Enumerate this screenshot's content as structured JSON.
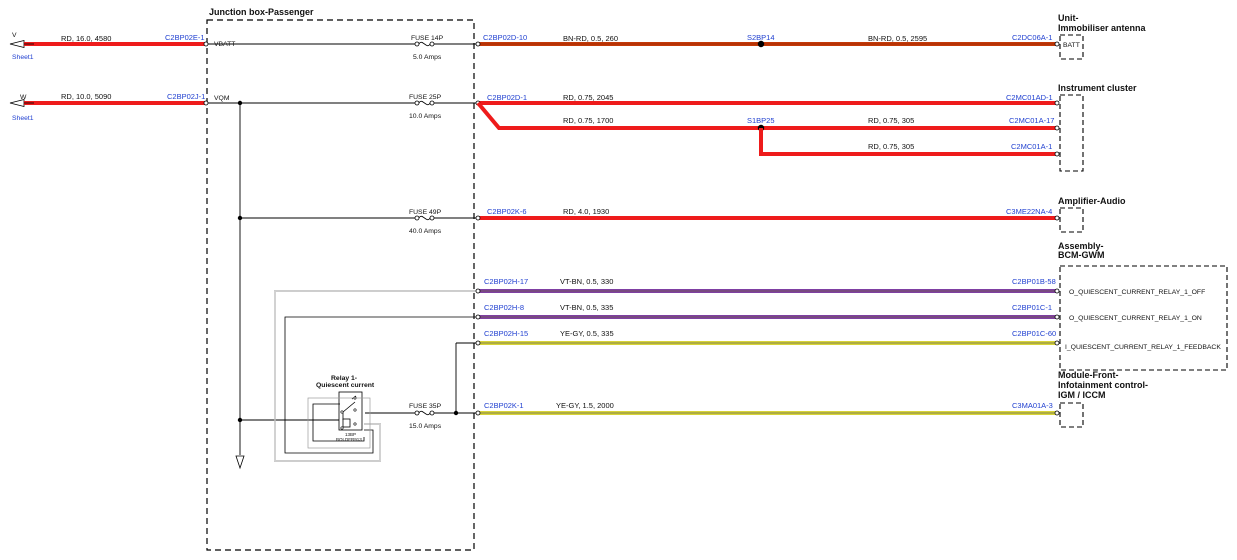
{
  "colors": {
    "rd": "#ee1b1b",
    "bn_rd": "#c43a08",
    "vt_bn": "#7f3fa3",
    "ye_gy": "#d8d438",
    "connector_text": "#1f3fd0",
    "line": "#000000"
  },
  "junction_box": {
    "title": "Junction box-Passenger"
  },
  "inputs": [
    {
      "arrow_label": "V",
      "sheet": "Sheet1",
      "wire": "RD,  16.0,  4580",
      "connector": "C2BP02E-1",
      "rail": "VBATT"
    },
    {
      "arrow_label": "W",
      "sheet": "Sheet1",
      "wire": "RD,  10.0,  5090",
      "connector": "C2BP02J-1",
      "rail": "VQM"
    }
  ],
  "fuses": [
    {
      "label": "FUSE 14P",
      "rating": "5.0 Amps"
    },
    {
      "label": "FUSE 25P",
      "rating": "10.0 Amps"
    },
    {
      "label": "FUSE 49P",
      "rating": "40.0 Amps"
    },
    {
      "label": "FUSE 35P",
      "rating": "15.0 Amps"
    }
  ],
  "relay": {
    "title_line1": "Relay 1-",
    "title_line2": "Quiescent current",
    "id": "13BP",
    "code": "BOLDFR913"
  },
  "wires": [
    {
      "from": "C2BP02D-10",
      "spec_a": "BN-RD,  0.5,  260",
      "splice": "S2BP14",
      "spec_b": "BN-RD,  0.5,  2595",
      "to": "C2DC06A-1"
    },
    {
      "from": "C2BP02D-1",
      "spec": "RD,  0.75,  2045",
      "to": "C2MC01AD-1"
    },
    {
      "spec_a": "RD,  0.75,  1700",
      "splice": "S1BP25",
      "spec_b": "RD,  0.75,  305",
      "to": "C2MC01A-17"
    },
    {
      "spec": "RD,  0.75,  305",
      "to": "C2MC01A-1"
    },
    {
      "from": "C2BP02K-6",
      "spec": "RD,  4.0,  1930",
      "to": "C3ME22NA-4"
    },
    {
      "from": "C2BP02H-17",
      "spec": "VT-BN,  0.5,  330",
      "to": "C2BP01B-58"
    },
    {
      "from": "C2BP02H-8",
      "spec": "VT-BN,  0.5,  335",
      "to": "C2BP01C-1"
    },
    {
      "from": "C2BP02H-15",
      "spec": "YE-GY,  0.5,  335",
      "to": "C2BP01C-60"
    },
    {
      "from": "C2BP02K-1",
      "spec": "YE-GY,  1.5,  2000",
      "to": "C3MA01A-3"
    }
  ],
  "components": {
    "immobiliser": {
      "line1": "Unit-",
      "line2": "Immobiliser antenna",
      "pin": "BATT"
    },
    "instrument_cluster": {
      "title": "Instrument cluster"
    },
    "amplifier": {
      "title": "Amplifier-Audio"
    },
    "bcm": {
      "line1": "Assembly-",
      "line2": "BCM-GWM",
      "pins": [
        "O_QUIESCENT_CURRENT_RELAY_1_OFF",
        "O_QUIESCENT_CURRENT_RELAY_1_ON",
        "I_QUIESCENT_CURRENT_RELAY_1_FEEDBACK"
      ]
    },
    "infotainment": {
      "line1": "Module-Front-",
      "line2": "Infotainment control-",
      "line3": "IGM / ICCM"
    }
  }
}
